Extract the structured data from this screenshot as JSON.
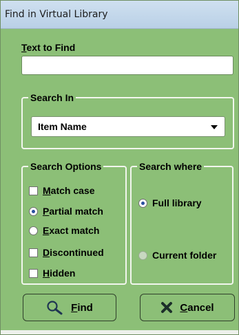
{
  "window": {
    "title": "Find in Virtual Library"
  },
  "text_to_find": {
    "label_underlined": "T",
    "label_rest": "ext to Find",
    "value": ""
  },
  "search_in": {
    "legend": "Search In",
    "selected": "Item Name"
  },
  "search_options": {
    "legend": "Search Options",
    "items": [
      {
        "type": "checkbox",
        "accel": "M",
        "rest": "atch case",
        "checked": false
      },
      {
        "type": "radio",
        "accel": "P",
        "rest": "artial match",
        "selected": true
      },
      {
        "type": "radio",
        "accel": "E",
        "rest": "xact match",
        "selected": false
      },
      {
        "type": "checkbox",
        "accel": "D",
        "rest": "iscontinued",
        "checked": false
      },
      {
        "type": "checkbox",
        "accel": "H",
        "rest": "idden",
        "checked": false
      }
    ]
  },
  "search_where": {
    "legend": "Search where",
    "items": [
      {
        "label": "Full library",
        "selected": true
      },
      {
        "label": "Current folder",
        "selected": false
      }
    ]
  },
  "buttons": {
    "find": {
      "accel": "F",
      "rest": "ind",
      "icon": "search-icon"
    },
    "cancel": {
      "accel": "C",
      "rest": "ancel",
      "icon": "close-icon"
    }
  },
  "colors": {
    "background": "#8cbf77",
    "group_border": "#f2f6ee",
    "radio_dot": "#2a4fa0"
  }
}
